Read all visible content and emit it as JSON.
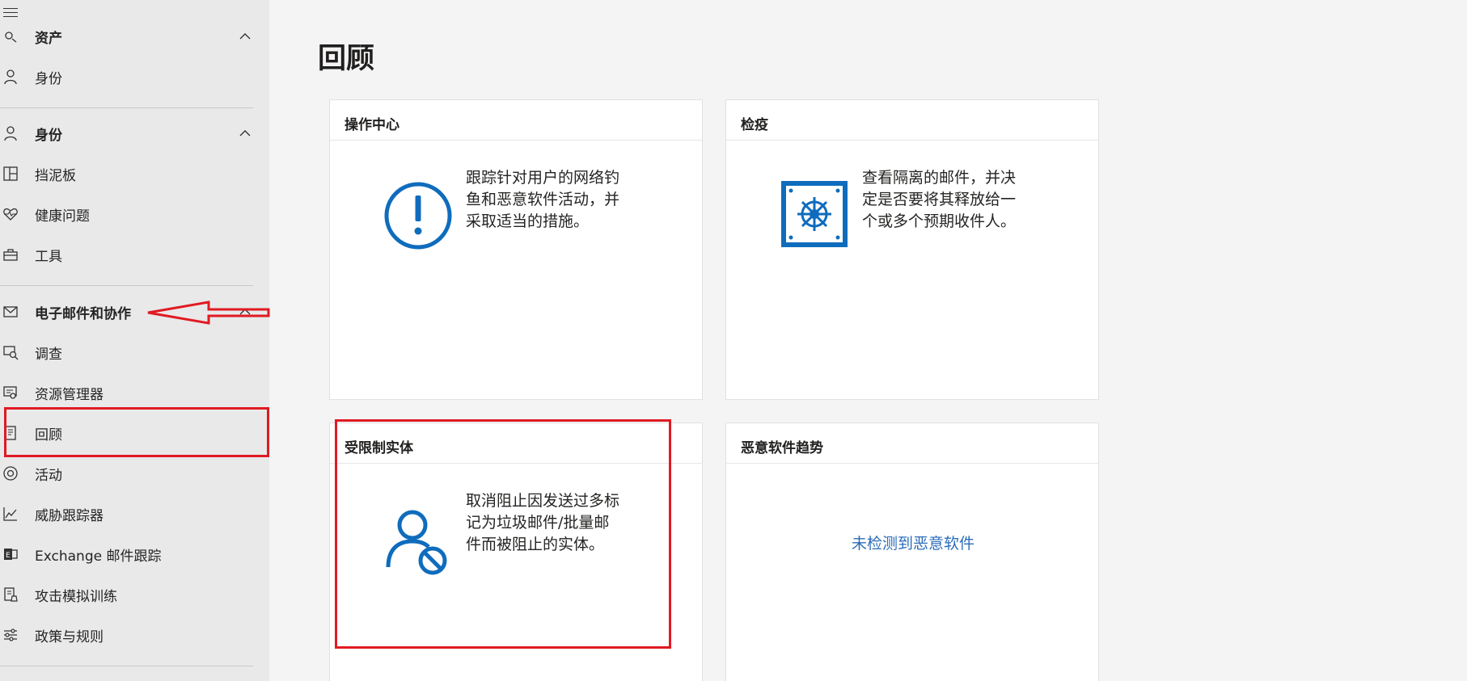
{
  "sidebar": {
    "items": [
      {
        "id": "assets-header",
        "label": "资产",
        "icon": "assets-icon",
        "bold": true,
        "chevron": "up"
      },
      {
        "id": "identity",
        "label": "身份",
        "icon": "person-icon"
      },
      {
        "id": "identity-header",
        "label": "身份",
        "icon": "person-icon",
        "bold": true,
        "chevron": "up"
      },
      {
        "id": "dashboard",
        "label": "挡泥板",
        "icon": "dashboard-icon"
      },
      {
        "id": "health",
        "label": "健康问题",
        "icon": "heart-pulse-icon"
      },
      {
        "id": "tools",
        "label": "工具",
        "icon": "toolbox-icon"
      },
      {
        "id": "email-header",
        "label": "电子邮件和协作",
        "icon": "mail-icon",
        "bold": true,
        "chevron": "up"
      },
      {
        "id": "investigation",
        "label": "调查",
        "icon": "investigation-icon"
      },
      {
        "id": "explorer",
        "label": "资源管理器",
        "icon": "explorer-icon"
      },
      {
        "id": "review",
        "label": "回顾",
        "icon": "document-icon"
      },
      {
        "id": "campaigns",
        "label": "活动",
        "icon": "target-icon"
      },
      {
        "id": "threat-tracker",
        "label": "威胁跟踪器",
        "icon": "chart-line-icon"
      },
      {
        "id": "exchange-trace",
        "label": "Exchange 邮件跟踪",
        "icon": "exchange-icon"
      },
      {
        "id": "attack-sim",
        "label": "攻击模拟训练",
        "icon": "flask-icon"
      },
      {
        "id": "policies",
        "label": "政策与规则",
        "icon": "sliders-icon"
      }
    ]
  },
  "main": {
    "title": "回顾",
    "cards": [
      {
        "title": "操作中心",
        "text": "跟踪针对用户的网络钓鱼和恶意软件活动，并采取适当的措施。",
        "icon": "alert-circle-icon"
      },
      {
        "title": "检疫",
        "text": "查看隔离的邮件，并决定是否要将其释放给一个或多个预期收件人。",
        "icon": "quarantine-vault-icon"
      },
      {
        "title": "受限制实体",
        "text": "取消阻止因发送过多标记为垃圾邮件/批量邮件而被阻止的实体。",
        "icon": "person-blocked-icon"
      },
      {
        "title": "恶意软件趋势",
        "link": "未检测到恶意软件"
      }
    ]
  },
  "colors": {
    "accent": "#0f6cbd",
    "link": "#2b6cb8",
    "highlight": "#e01a22",
    "sidebar_bg": "#e9e9e9",
    "page_bg": "#f4f4f4"
  }
}
